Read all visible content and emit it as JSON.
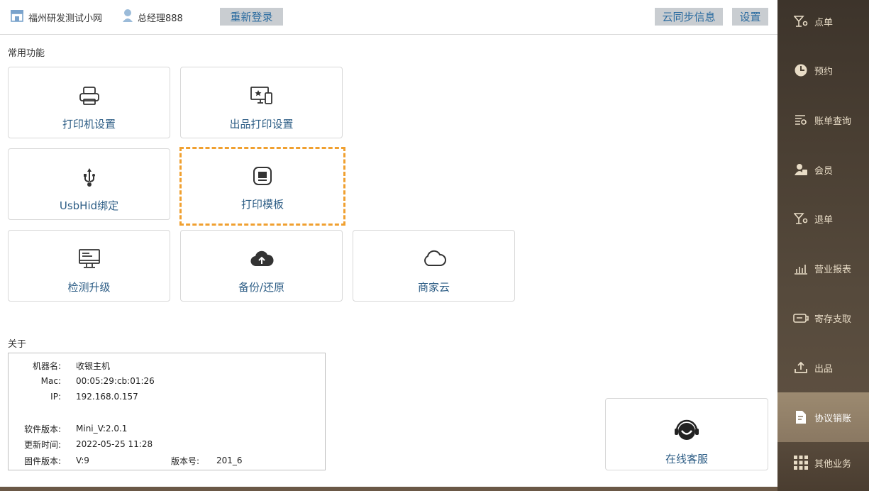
{
  "header": {
    "shop_name": "福州研发测试小网",
    "user_name": "总经理888",
    "relogin_label": "重新登录",
    "cloud_sync_label": "云同步信息",
    "settings_label": "设置"
  },
  "common": {
    "title": "常用功能",
    "tiles": [
      {
        "label": "打印机设置",
        "icon": "printer-icon"
      },
      {
        "label": "出品打印设置",
        "icon": "display-print-icon"
      },
      {
        "label": "UsbHid绑定",
        "icon": "usb-icon"
      },
      {
        "label": "打印模板",
        "icon": "template-icon"
      },
      {
        "label": "检测升级",
        "icon": "monitor-icon"
      },
      {
        "label": "备份/还原",
        "icon": "cloud-upload-icon"
      },
      {
        "label": "商家云",
        "icon": "cloud-icon"
      }
    ]
  },
  "about": {
    "title": "关于",
    "machine_name_key": "机器名:",
    "machine_name": "收银主机",
    "mac_key": "Mac:",
    "mac": "00:05:29:cb:01:26",
    "ip_key": "IP:",
    "ip": "192.168.0.157",
    "software_key": "软件版本:",
    "software": "Mini_V:2.0.1",
    "update_key": "更新时间:",
    "update_time": "2022-05-25 11:28",
    "firmware_key": "固件版本:",
    "firmware": "V:9",
    "version_no_key": "版本号:",
    "version_no": "201_6"
  },
  "service": {
    "label": "在线客服",
    "icon": "headset-icon"
  },
  "sidebar": {
    "items": [
      {
        "label": "点单"
      },
      {
        "label": "预约"
      },
      {
        "label": "账单查询"
      },
      {
        "label": "会员"
      },
      {
        "label": "退单"
      },
      {
        "label": "营业报表"
      },
      {
        "label": "寄存支取"
      },
      {
        "label": "出品"
      },
      {
        "label": "协议销账"
      },
      {
        "label": "其他业务"
      }
    ],
    "active_index": 8
  },
  "colors": {
    "accent_button_text": "#2c6ca0",
    "tile_label": "#2e5e86",
    "selected_dash": "#f0a030",
    "sidebar_text": "#e8dcc6"
  }
}
